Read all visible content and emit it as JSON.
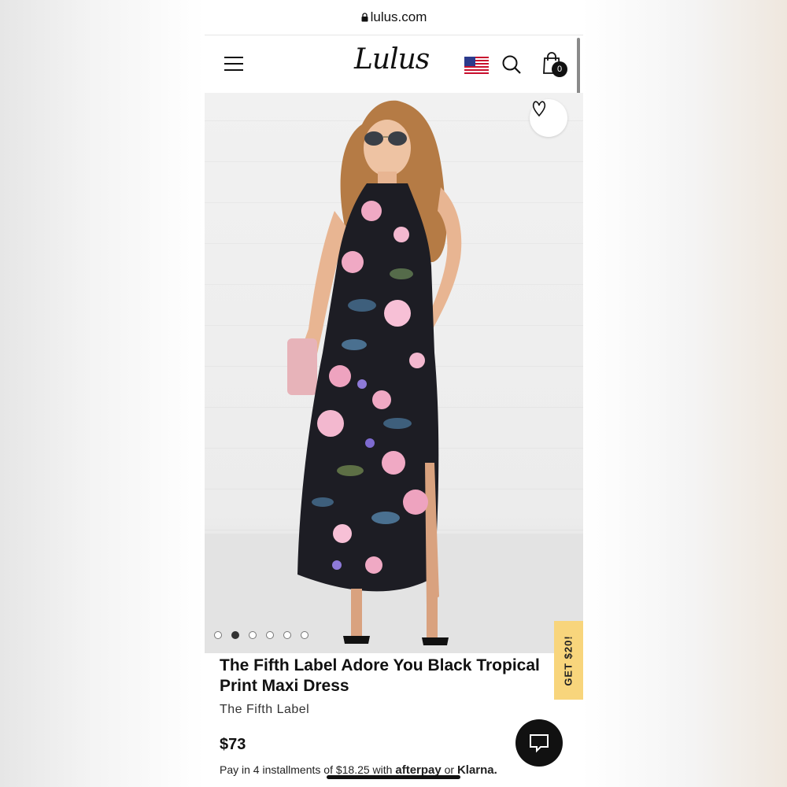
{
  "browser": {
    "url": "lulus.com"
  },
  "header": {
    "logo": "Lulus",
    "menu_icon": "hamburger-menu-icon",
    "flag_icon": "us-flag-icon",
    "search_icon": "search-icon",
    "bag_icon": "shopping-bag-icon",
    "bag_count": "0"
  },
  "gallery": {
    "image_count": 6,
    "active_index": 1,
    "wishlist_icon": "heart-icon"
  },
  "promo": {
    "label": "GET $20!"
  },
  "product": {
    "title": "The Fifth Label Adore You Black Tropical Print Maxi Dress",
    "brand": "The Fifth Label",
    "price": "$73",
    "installments_text": "Pay in 4 installments of $18.25 with",
    "afterpay_label": "afterpay",
    "or_text": "or",
    "klarna_label": "Klarna."
  },
  "chat": {
    "icon": "chat-icon"
  },
  "colors": {
    "promo": "#f8d57c",
    "dress": "#1d1d24",
    "accent_pink": "#f0a9c4"
  }
}
